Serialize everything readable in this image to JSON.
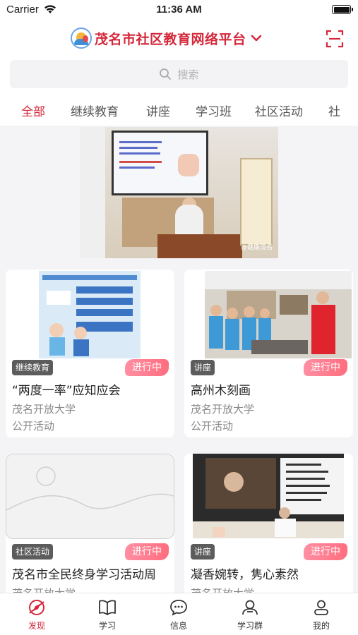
{
  "status_bar": {
    "carrier": "Carrier",
    "time": "11:36 AM"
  },
  "header": {
    "title": "茂名市社区教育网络平台"
  },
  "search": {
    "placeholder": "搜索"
  },
  "tabs": [
    {
      "label": "全部",
      "active": true
    },
    {
      "label": "继续教育",
      "active": false
    },
    {
      "label": "讲座",
      "active": false
    },
    {
      "label": "学习班",
      "active": false
    },
    {
      "label": "社区活动",
      "active": false
    },
    {
      "label": "社",
      "active": false
    }
  ],
  "banner": {
    "watermark": "@健康茂名"
  },
  "cards": [
    {
      "badge": "继续教育",
      "status": "进行中",
      "title": "“两度一率”应知应会",
      "org": "茂名开放大学",
      "type": "公开活动"
    },
    {
      "badge": "讲座",
      "status": "进行中",
      "title": "高州木刻画",
      "org": "茂名开放大学",
      "type": "公开活动"
    },
    {
      "badge": "社区活动",
      "status": "进行中",
      "title": "茂名市全民终身学习活动周",
      "org": "茂名开放大学",
      "type": ""
    },
    {
      "badge": "讲座",
      "status": "进行中",
      "title": "凝香婉转，隽心素然",
      "org": "茂名开放大学",
      "type": ""
    }
  ],
  "tabbar": [
    {
      "label": "发现",
      "icon": "discover-icon",
      "active": true
    },
    {
      "label": "学习",
      "icon": "book-icon",
      "active": false
    },
    {
      "label": "信息",
      "icon": "message-icon",
      "active": false
    },
    {
      "label": "学习群",
      "icon": "group-icon",
      "active": false
    },
    {
      "label": "我的",
      "icon": "profile-icon",
      "active": false
    }
  ],
  "colors": {
    "accent": "#d4283b",
    "status_pill": "#ff7a8c",
    "badge_bg": "#5c5c5c"
  }
}
